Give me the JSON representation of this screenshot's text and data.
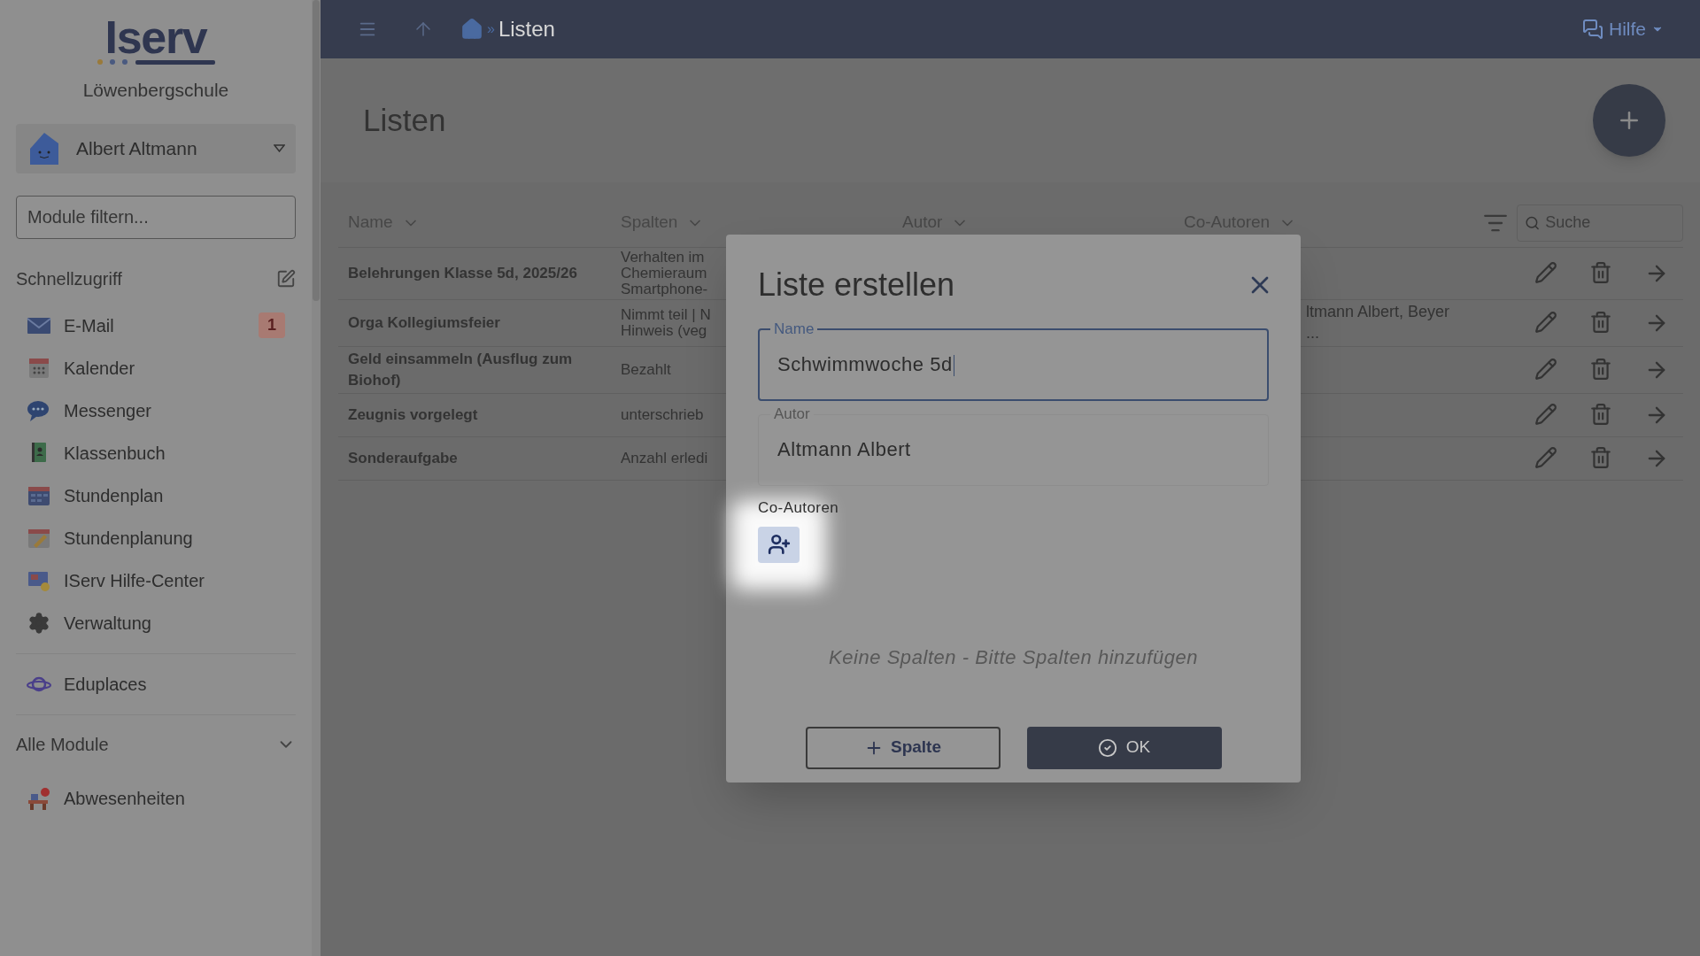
{
  "sidebar": {
    "logo": "Iserv",
    "school": "Löwenbergschule",
    "user": {
      "name": "Albert Altmann"
    },
    "filter": {
      "placeholder": "Module filtern..."
    },
    "quick_access": {
      "title": "Schnellzugriff",
      "items": [
        {
          "label": "E-Mail",
          "badge": "1"
        },
        {
          "label": "Kalender"
        },
        {
          "label": "Messenger"
        },
        {
          "label": "Klassenbuch"
        },
        {
          "label": "Stundenplan"
        },
        {
          "label": "Stundenplanung"
        },
        {
          "label": "IServ Hilfe-Center"
        },
        {
          "label": "Verwaltung"
        }
      ]
    },
    "extra_items": [
      {
        "label": "Eduplaces"
      }
    ],
    "all_modules": {
      "title": "Alle Module",
      "items": [
        {
          "label": "Abwesenheiten"
        }
      ]
    }
  },
  "topbar": {
    "separator": "»",
    "current": "Listen",
    "help": "Hilfe"
  },
  "page": {
    "title": "Listen"
  },
  "table": {
    "columns": [
      "Name",
      "Spalten",
      "Autor",
      "Co-Autoren"
    ],
    "search": {
      "placeholder": "Suche"
    },
    "rows": [
      {
        "name": "Belehrungen Klasse 5d, 2025/26",
        "spalten": "Verhalten im\nChemieraum\nSmartphone-",
        "co_autoren": ""
      },
      {
        "name": "Orga Kollegiumsfeier",
        "spalten": "Nimmt teil | N\nHinweis (veg",
        "co_autoren": "ltmann Albert, Beyer\n..."
      },
      {
        "name": "Geld einsammeln (Ausflug zum Biohof)",
        "spalten": "Bezahlt",
        "co_autoren": ""
      },
      {
        "name": "Zeugnis vorgelegt",
        "spalten": "unterschrieb",
        "co_autoren": ""
      },
      {
        "name": "Sonderaufgabe",
        "spalten": "Anzahl erledi",
        "co_autoren": ""
      }
    ]
  },
  "dialog": {
    "title": "Liste erstellen",
    "name_field": {
      "label": "Name",
      "value": "Schwimmwoche 5d"
    },
    "author_field": {
      "label": "Autor",
      "value": "Altmann Albert"
    },
    "coauthors": {
      "label": "Co-Autoren"
    },
    "empty_text": "Keine Spalten - Bitte Spalten hinzufügen",
    "buttons": [
      {
        "kind": "secondary",
        "label": "Spalte"
      },
      {
        "kind": "primary",
        "label": "OK"
      }
    ]
  }
}
